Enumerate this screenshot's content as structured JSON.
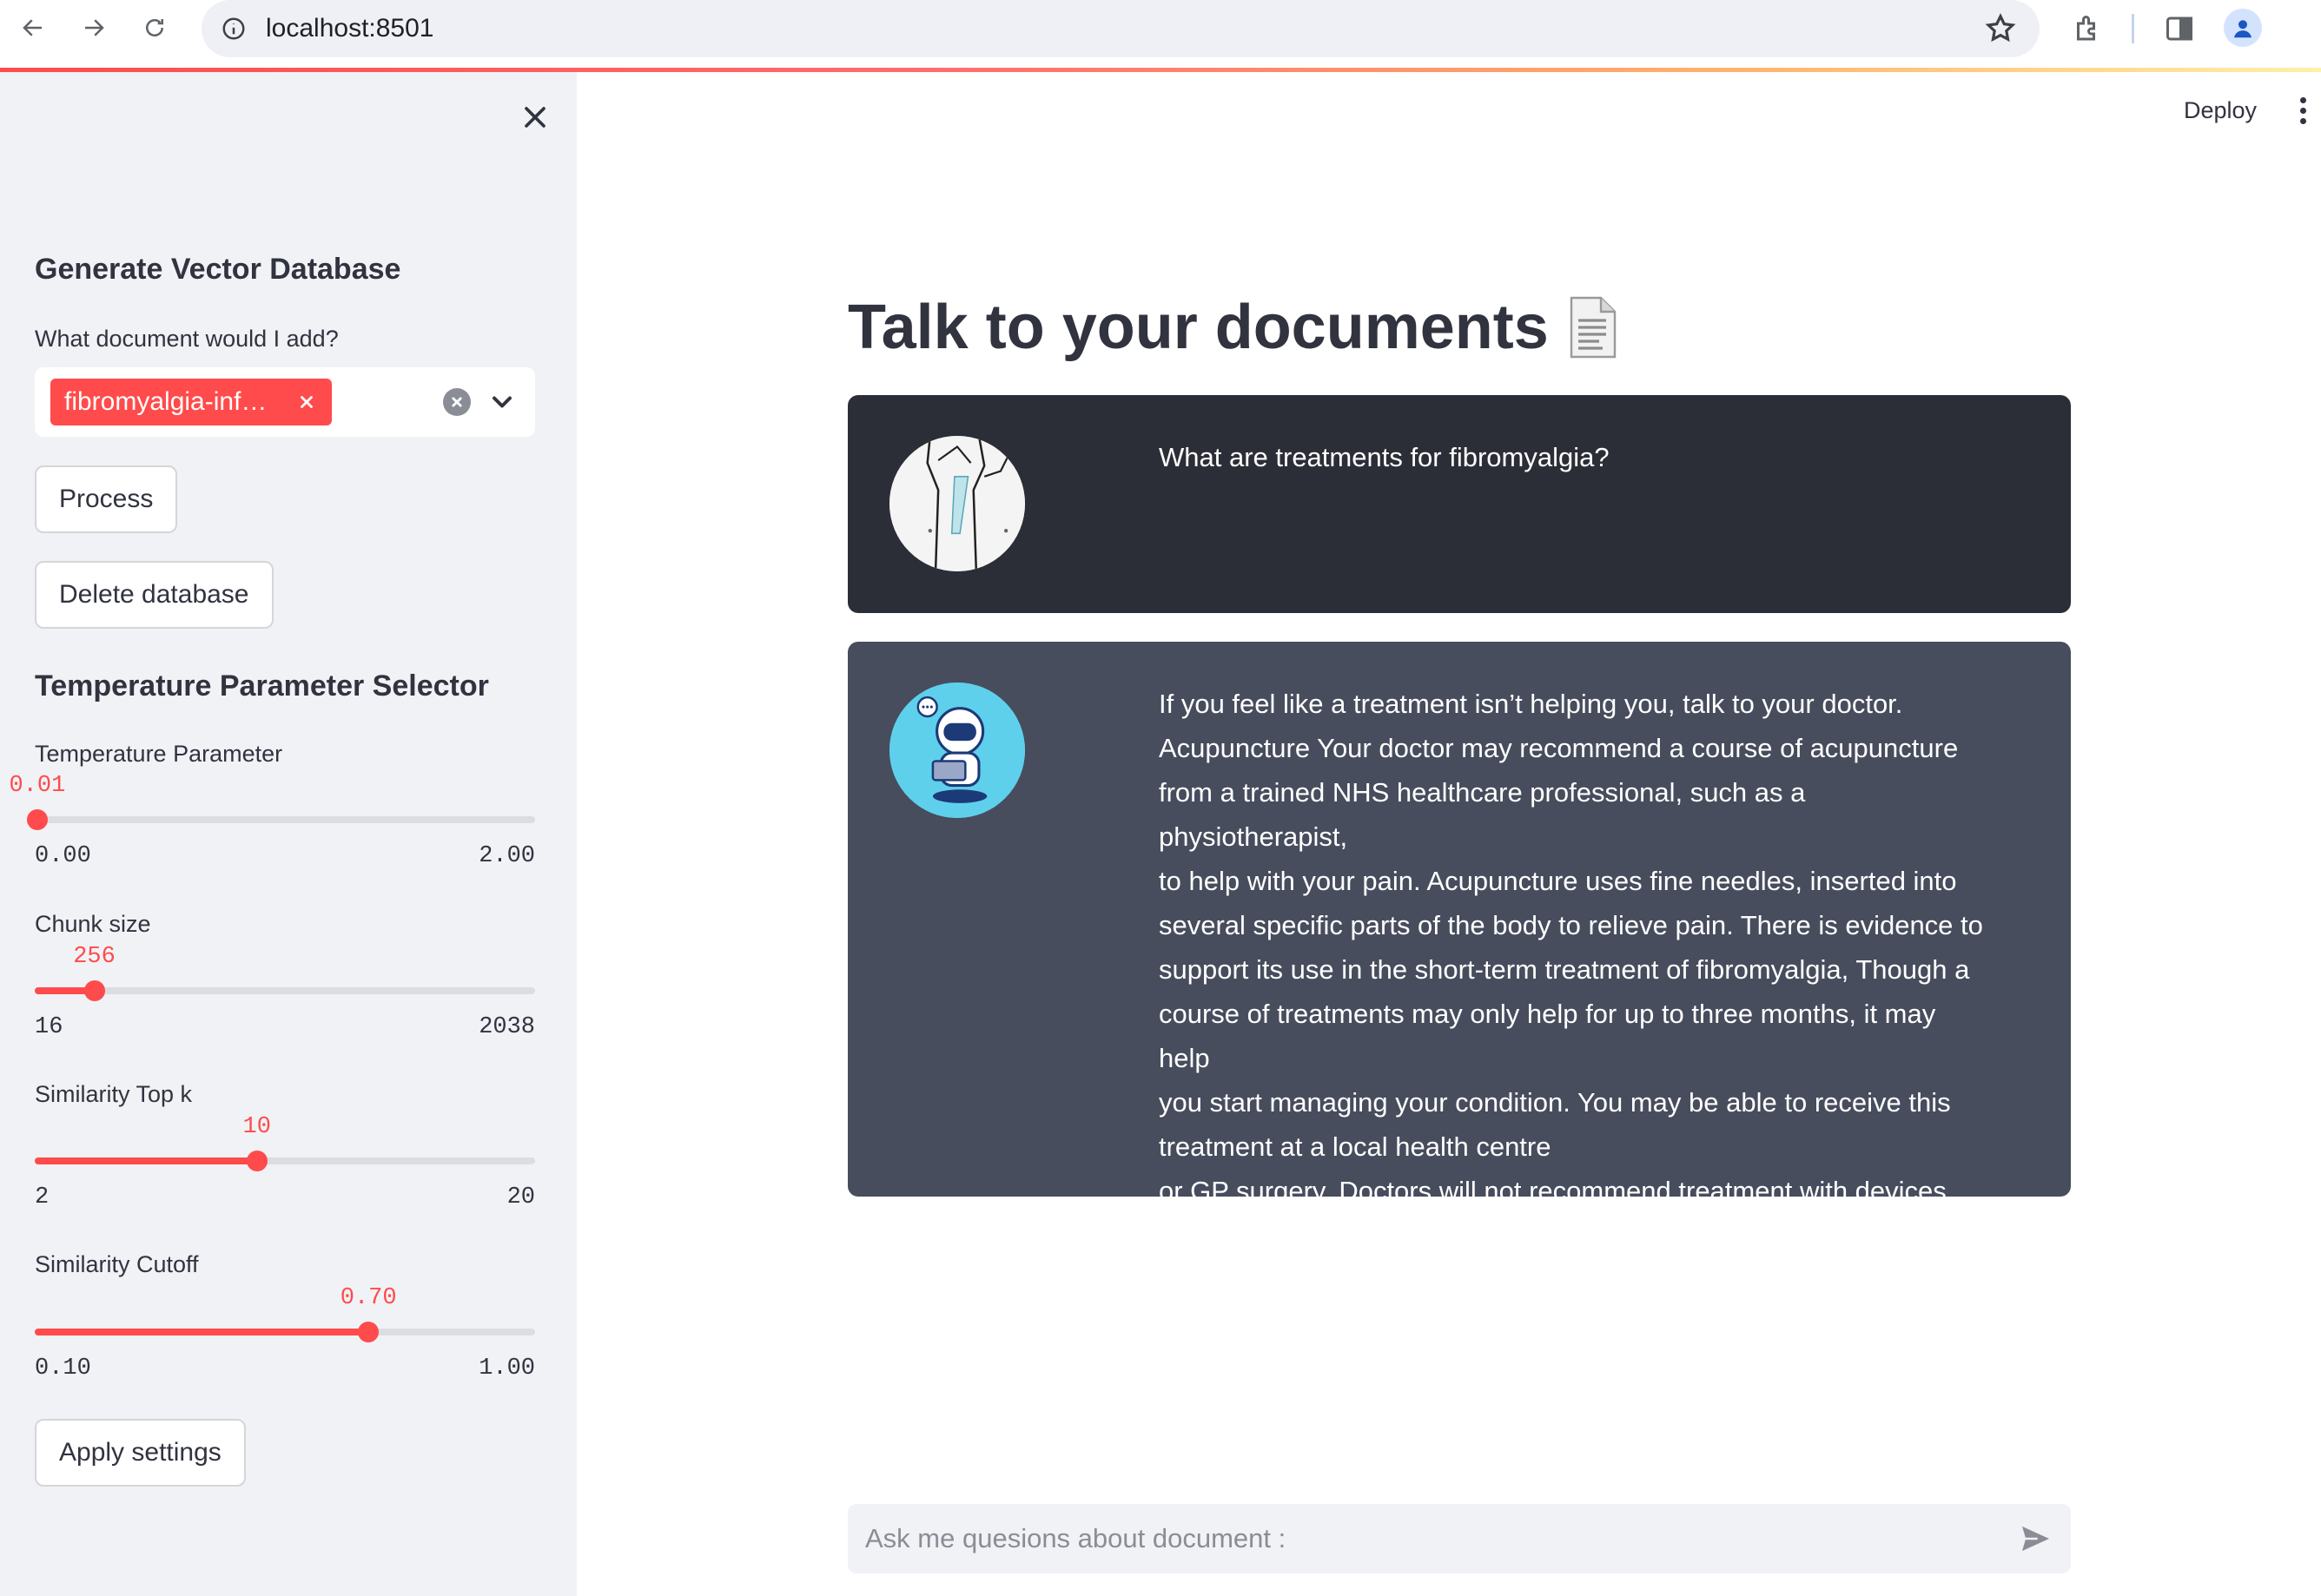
{
  "browser": {
    "url": "localhost:8501"
  },
  "sidebar": {
    "section_vector_db": "Generate Vector Database",
    "doc_select_label": "What document would I add?",
    "selected_doc": "fibromyalgia-inf…",
    "process_button": "Process",
    "delete_button": "Delete database",
    "section_temperature": "Temperature Parameter Selector",
    "sliders": [
      {
        "label": "Temperature Parameter",
        "value": "0.01",
        "min": "0.00",
        "max": "2.00",
        "fraction": 0.005
      },
      {
        "label": "Chunk size",
        "value": "256",
        "min": "16",
        "max": "2038",
        "fraction": 0.119
      },
      {
        "label": "Similarity Top k",
        "value": "10",
        "min": "2",
        "max": "20",
        "fraction": 0.444
      },
      {
        "label": "Similarity Cutoff",
        "value": "0.70",
        "min": "0.10",
        "max": "1.00",
        "fraction": 0.667
      }
    ],
    "apply_button": "Apply settings"
  },
  "header": {
    "deploy": "Deploy"
  },
  "main": {
    "title": "Talk to your documents",
    "messages": [
      {
        "role": "user",
        "text": "What are treatments for fibromyalgia?"
      },
      {
        "role": "assistant",
        "lines": [
          "If you feel like a treatment isn’t helping you, talk to your doctor.",
          "Acupuncture Your doctor may recommend a course of acupuncture",
          "from a trained NHS healthcare professional, such as a physiotherapist,",
          "to help with your pain. Acupuncture uses fine needles, inserted into",
          "several specific parts of the body to relieve pain. There is evidence to",
          "support its use in the short-term treatment of fibromyalgia, Though a",
          "course of treatments may only help for up to three months, it may help",
          "you start managing your condition. You may be able to receive this",
          "treatment at a local health centre",
          "or GP surgery. Doctors will not recommend treatment with devices"
        ]
      }
    ],
    "chat_placeholder": "Ask me quesions about document :"
  },
  "colors": {
    "accent": "#ff4b4b",
    "sidebar_bg": "#f0f2f6",
    "user_msg_bg": "#2c2e37",
    "bot_msg_bg": "#474d5d"
  }
}
